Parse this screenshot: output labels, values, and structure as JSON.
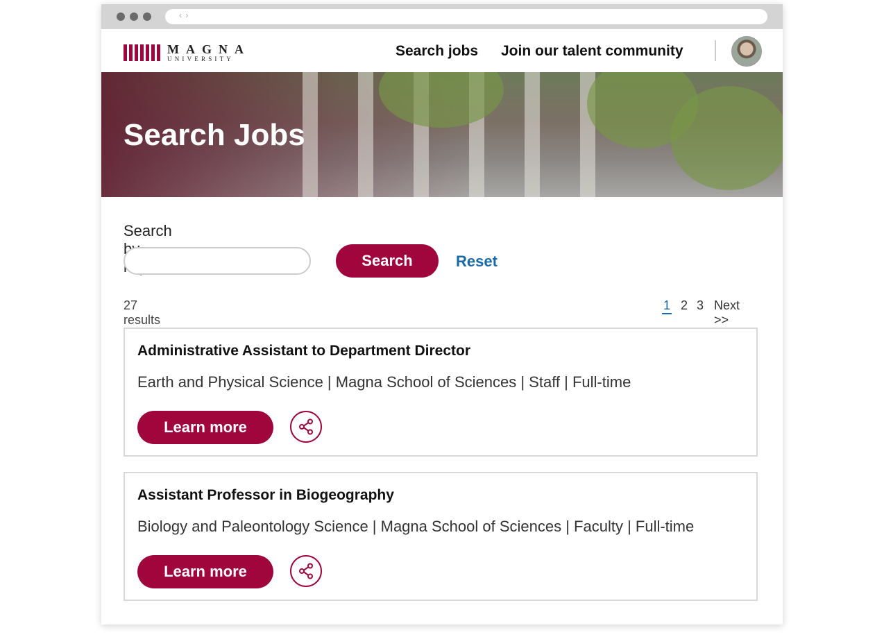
{
  "browser": {
    "nav_arrows": "‹ ›"
  },
  "header": {
    "logo_name": "MAGNA",
    "logo_sub": "UNIVERSITY",
    "nav": {
      "search_jobs": "Search jobs",
      "join": "Join our talent community"
    }
  },
  "hero": {
    "title": "Search Jobs"
  },
  "search": {
    "label": "Search by keyword",
    "input_value": "",
    "placeholder": "",
    "button_label": "Search",
    "reset_label": "Reset"
  },
  "results": {
    "count_text": "27 results",
    "pages": [
      "1",
      "2",
      "3"
    ],
    "current_page": "1",
    "next_label": "Next >>"
  },
  "jobs": [
    {
      "title": "Administrative Assistant to Department Director",
      "meta": "Earth and Physical Science | Magna School of Sciences | Staff | Full-time",
      "button_label": "Learn more"
    },
    {
      "title": "Assistant Professor in Biogeography",
      "meta": "Biology and Paleontology Science | Magna School of Sciences | Faculty | Full-time",
      "button_label": "Learn more"
    }
  ],
  "colors": {
    "brand": "#a0063b",
    "link": "#1a6aa8"
  },
  "icons": {
    "share": "share-icon",
    "avatar": "avatar"
  }
}
